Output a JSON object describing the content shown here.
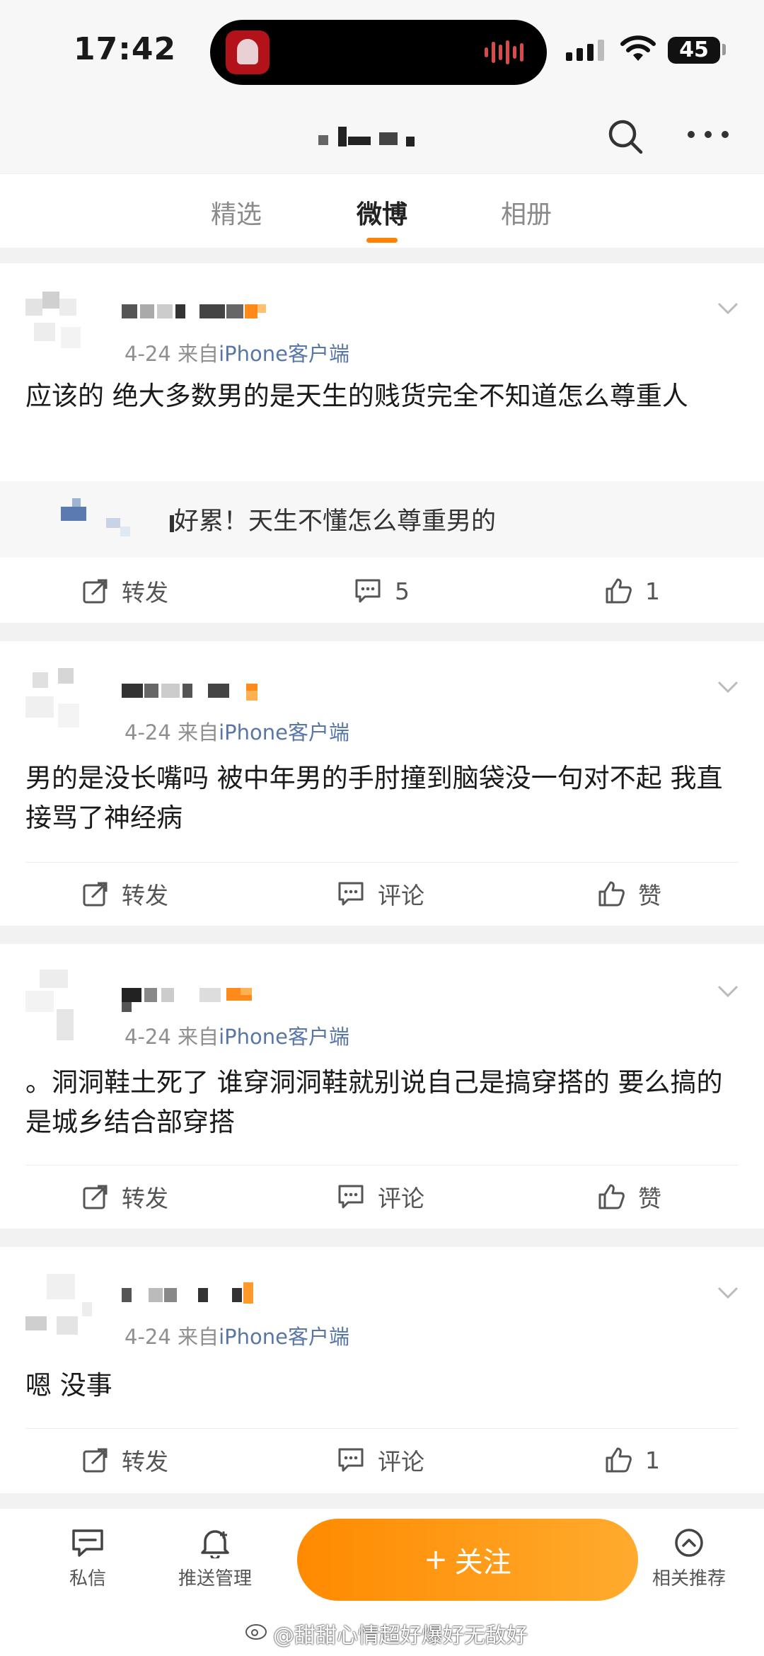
{
  "status_bar": {
    "time": "17:42",
    "battery": "45"
  },
  "header": {
    "search_icon": "search-icon",
    "more_icon": "more-icon"
  },
  "tabs": [
    {
      "label": "精选",
      "active": false
    },
    {
      "label": "微博",
      "active": true
    },
    {
      "label": "相册",
      "active": false
    }
  ],
  "posts": [
    {
      "date": "4-24",
      "source_prefix": "来自",
      "source": "iPhone客户端",
      "text": "应该的 绝大多数男的是天生的贱货完全不知道怎么尊重人",
      "quote": "好累！天生不懂怎么尊重男的",
      "repost": "转发",
      "comment": "5",
      "like": "1"
    },
    {
      "date": "4-24",
      "source_prefix": "来自",
      "source": "iPhone客户端",
      "text": "男的是没长嘴吗 被中年男的手肘撞到脑袋没一句对不起 我直接骂了神经病",
      "repost": "转发",
      "comment": "评论",
      "like": "赞"
    },
    {
      "date": "4-24",
      "source_prefix": "来自",
      "source": "iPhone客户端",
      "text": "。洞洞鞋土死了 谁穿洞洞鞋就别说自己是搞穿搭的 要么搞的是城乡结合部穿搭",
      "repost": "转发",
      "comment": "评论",
      "like": "赞"
    },
    {
      "date": "4-24",
      "source_prefix": "来自",
      "source": "iPhone客户端",
      "text": "嗯 没事",
      "repost": "转发",
      "comment": "评论",
      "like": "1"
    }
  ],
  "bottom_bar": {
    "message": "私信",
    "push": "推送管理",
    "follow": "关注",
    "follow_plus": "+",
    "recommend": "相关推荐"
  },
  "watermark": "@甜甜心情超好爆好无敌好",
  "colors": {
    "accent": "#ff8200",
    "source_link": "#5877a7",
    "background": "#f2f2f2"
  }
}
